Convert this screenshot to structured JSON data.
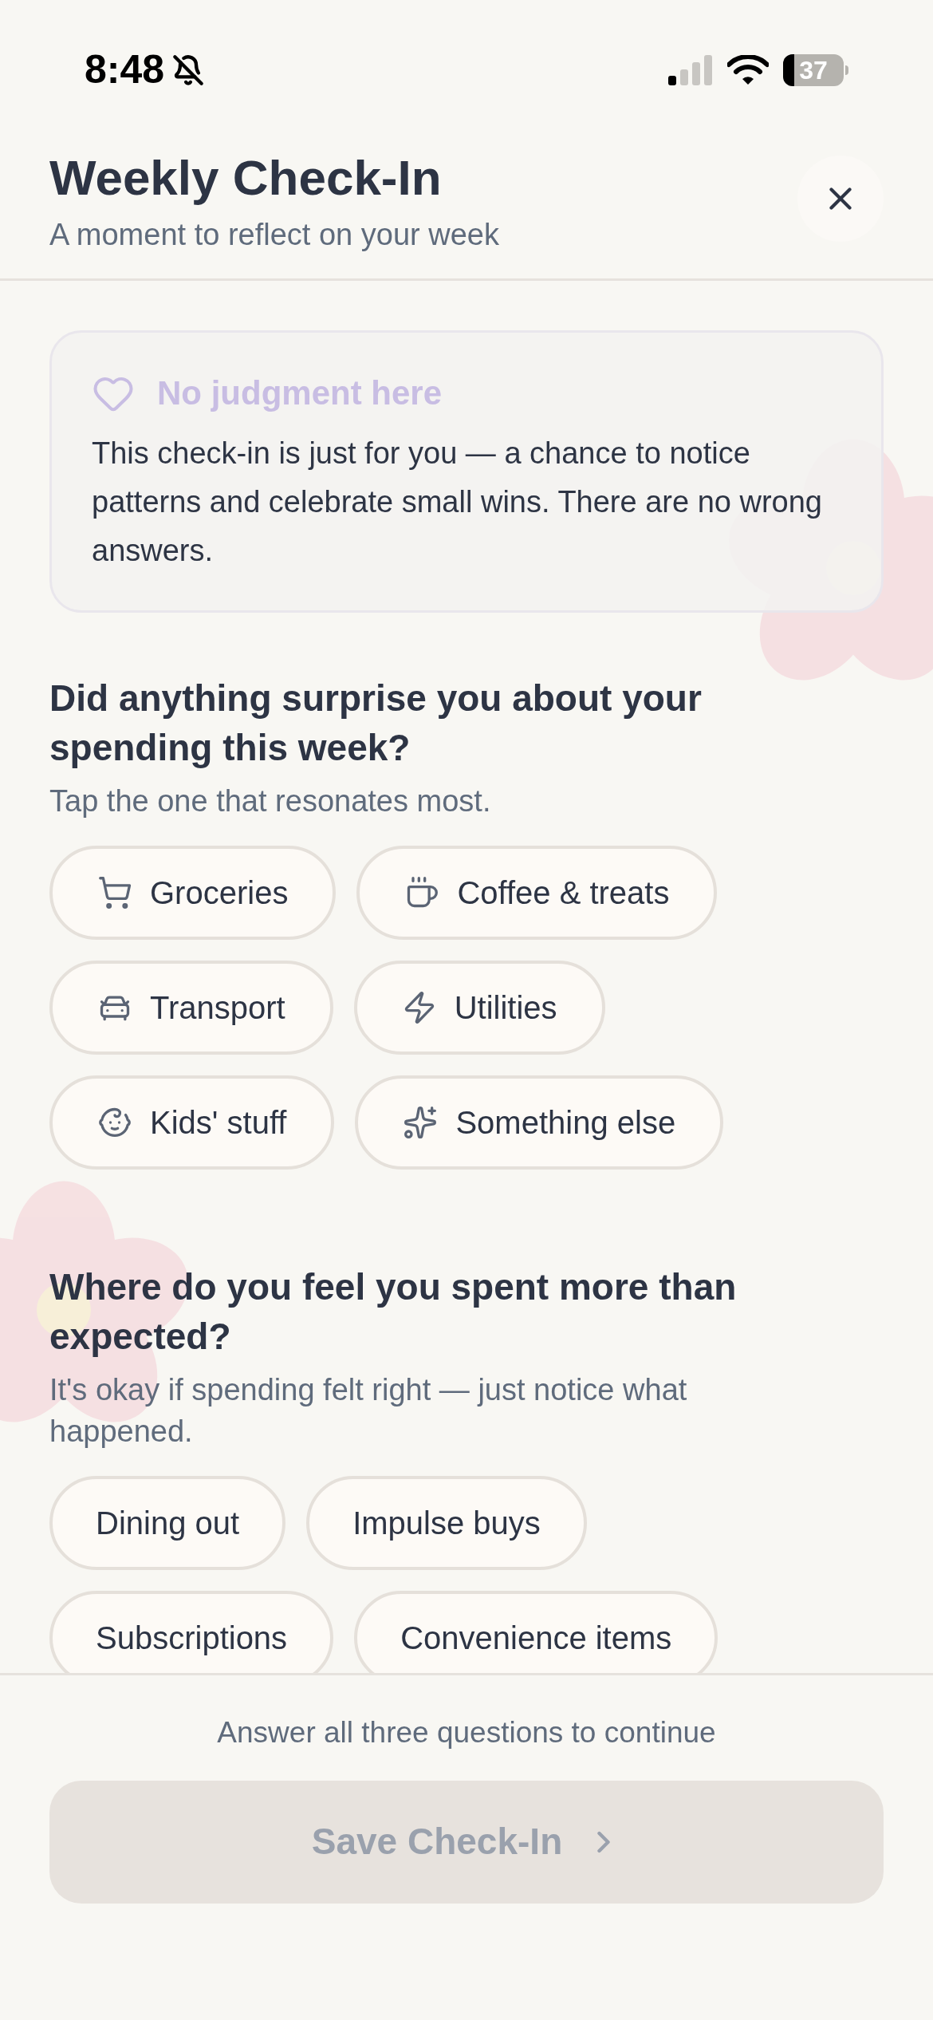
{
  "status_bar": {
    "time": "8:48",
    "battery": "37"
  },
  "header": {
    "title": "Weekly Check-In",
    "subtitle": "A moment to reflect on your week"
  },
  "notice": {
    "title": "No judgment here",
    "body": "This check-in is just for you — a chance to notice patterns and celebrate small wins. There are no wrong answers."
  },
  "questions": [
    {
      "kind": "icon_chips",
      "title": "Did anything surprise you about your spending this week?",
      "hint": "Tap the one that resonates most.",
      "options": [
        {
          "label": "Groceries",
          "selected": false
        },
        {
          "label": "Coffee & treats",
          "selected": false
        },
        {
          "label": "Transport",
          "selected": false
        },
        {
          "label": "Utilities",
          "selected": false
        },
        {
          "label": "Kids' stuff",
          "selected": false
        },
        {
          "label": "Something else",
          "selected": false
        }
      ]
    },
    {
      "kind": "text_chips",
      "title": "Where do you feel you spent more than expected?",
      "hint": "It's okay if spending felt right — just notice what happened.",
      "options": [
        {
          "label": "Dining out",
          "selected": false
        },
        {
          "label": "Impulse buys",
          "selected": false
        },
        {
          "label": "Subscriptions",
          "selected": false
        },
        {
          "label": "Convenience items",
          "selected": false
        }
      ]
    }
  ],
  "footer": {
    "message": "Answer all three questions to continue",
    "button": {
      "label": "Save Check-In",
      "disabled": true
    }
  }
}
